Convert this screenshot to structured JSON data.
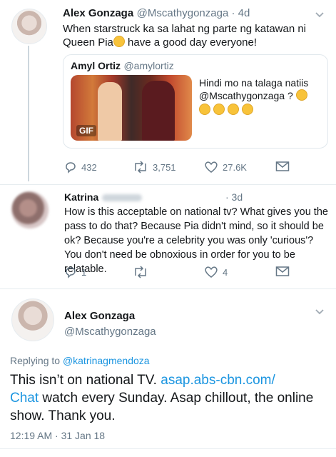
{
  "tweet1": {
    "name": "Alex Gonzaga",
    "handle_time": "@Mscathygonzaga · 4d",
    "text_line1": "When starstruck ka sa lahat ng parte ng katawan ni",
    "text_line2": "Queen Pia",
    "text_line2_end": " have a good day everyone!",
    "quote": {
      "name": "Amyl Ortiz",
      "handle": "@amylortiz",
      "text_line1": "Hindi mo na talaga natiis",
      "text_line2": "@Mscathygonzaga ?",
      "gif_label": "GIF"
    },
    "actions": {
      "replies": "432",
      "retweets": "3,751",
      "likes": "27.6K"
    }
  },
  "tweet2": {
    "name": "Katrina",
    "time": "· 3d",
    "text": "How is this acceptable on national tv? What gives you the pass to do that? Because Pia didn't mind, so it should be ok? Because you're a celebrity you was only 'curious'? You don't need be obnoxious in order for you to be relatable.",
    "actions": {
      "replies": "1",
      "likes": "4"
    }
  },
  "tweet3": {
    "name": "Alex Gonzaga",
    "handle": "@Mscathygonzaga",
    "replying_prefix": "Replying to ",
    "replying_handle": "@katrinagmendoza",
    "text_part1": "This isn’t on national TV. ",
    "link_line1": "asap.abs-cbn.com/",
    "link_line2": "Chat",
    "text_part2": " watch every Sunday. Asap chillout, the online show. Thank you.",
    "timestamp": "12:19 AM · 31 Jan 18"
  },
  "colors": {
    "accent": "#1b95e0",
    "muted": "#657786",
    "divider": "#e6ecf0"
  }
}
